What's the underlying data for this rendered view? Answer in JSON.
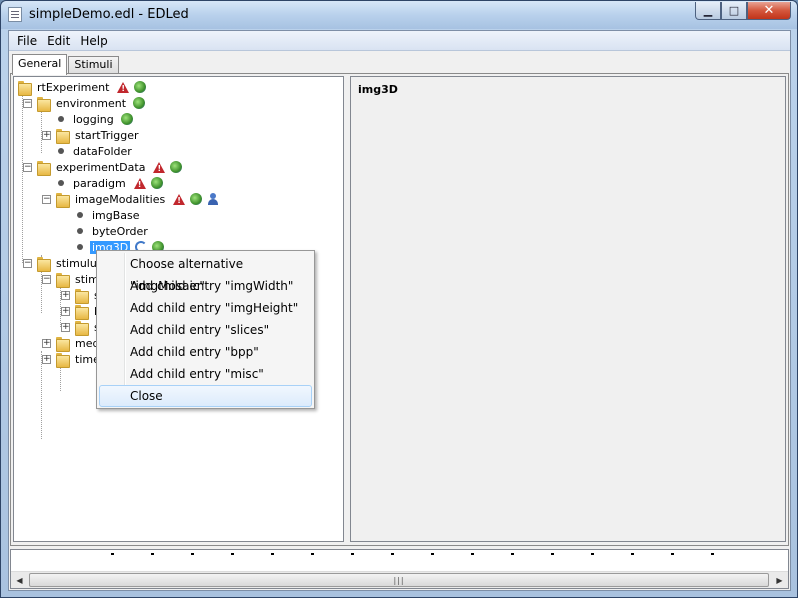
{
  "window": {
    "title": "simpleDemo.edl - EDLed"
  },
  "caption_buttons": {
    "minimize": "▁",
    "maximize": "□",
    "close": "✕"
  },
  "menubar": {
    "items": [
      "File",
      "Edit",
      "Help"
    ]
  },
  "tabs": [
    {
      "label": "General",
      "active": true
    },
    {
      "label": "Stimuli",
      "active": false
    }
  ],
  "tree": {
    "nodes": [
      {
        "label": "rtExperiment",
        "kind": "folder",
        "icons": [
          "warning-icon",
          "globe-icon"
        ]
      },
      {
        "label": "environment",
        "kind": "folder",
        "icons": [
          "globe-icon"
        ]
      },
      {
        "label": "logging",
        "kind": "leaf",
        "icons": [
          "globe-icon"
        ]
      },
      {
        "label": "startTrigger",
        "kind": "folder",
        "icons": []
      },
      {
        "label": "dataFolder",
        "kind": "leaf",
        "icons": []
      },
      {
        "label": "experimentData",
        "kind": "folder",
        "icons": [
          "warning-icon",
          "globe-icon"
        ]
      },
      {
        "label": "paradigm",
        "kind": "leaf",
        "icons": [
          "warning-icon",
          "globe-icon"
        ]
      },
      {
        "label": "imageModalities",
        "kind": "folder",
        "icons": [
          "warning-icon",
          "globe-icon",
          "person-icon"
        ]
      },
      {
        "label": "imgBase",
        "kind": "leaf",
        "icons": []
      },
      {
        "label": "byteOrder",
        "kind": "leaf",
        "icons": []
      },
      {
        "label": "img3D",
        "kind": "leaf",
        "icons": [
          "loop-icon",
          "globe-icon"
        ],
        "selected": true
      },
      {
        "label": "stimulusD",
        "kind": "folder",
        "icons": []
      },
      {
        "label": "stimE",
        "kind": "folder",
        "icons": []
      },
      {
        "label": "st",
        "kind": "folder",
        "icons": []
      },
      {
        "label": "lo",
        "kind": "folder",
        "icons": []
      },
      {
        "label": "sc",
        "kind": "folder",
        "icons": []
      },
      {
        "label": "media",
        "kind": "folder",
        "icons": []
      },
      {
        "label": "timeT",
        "kind": "folder",
        "icons": []
      }
    ]
  },
  "detail": {
    "title": "img3D"
  },
  "context_menu": {
    "items": [
      "Choose alternative \"imgMosaic\"",
      "Add child entry \"imgWidth\"",
      "Add child entry \"imgHeight\"",
      "Add child entry \"slices\"",
      "Add child entry \"bpp\"",
      "Add child entry \"misc\"",
      "Close"
    ],
    "highlighted_index": 6
  },
  "scrollbar": {
    "left_arrow": "◀",
    "right_arrow": "▶",
    "grip": "|||"
  }
}
